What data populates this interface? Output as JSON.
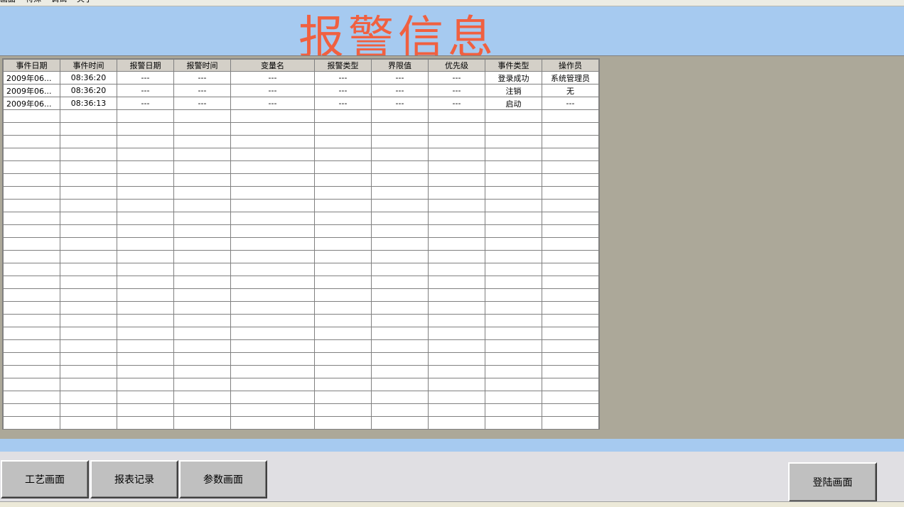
{
  "menu": [
    "画面",
    "特殊",
    "调试",
    "关于"
  ],
  "header": {
    "title": "报警信息"
  },
  "table": {
    "columns": [
      {
        "label": "事件日期",
        "width": 80
      },
      {
        "label": "事件时间",
        "width": 80
      },
      {
        "label": "报警日期",
        "width": 80
      },
      {
        "label": "报警时间",
        "width": 80
      },
      {
        "label": "变量名",
        "width": 118
      },
      {
        "label": "报警类型",
        "width": 80
      },
      {
        "label": "界限值",
        "width": 80
      },
      {
        "label": "优先级",
        "width": 80
      },
      {
        "label": "事件类型",
        "width": 80
      },
      {
        "label": "操作员",
        "width": 80
      }
    ],
    "rows": [
      [
        "2009年06...",
        "08:36:20",
        "---",
        "---",
        "---",
        "---",
        "---",
        "---",
        "登录成功",
        "系统管理员"
      ],
      [
        "2009年06...",
        "08:36:20",
        "---",
        "---",
        "---",
        "---",
        "---",
        "---",
        "注销",
        "无"
      ],
      [
        "2009年06...",
        "08:36:13",
        "---",
        "---",
        "---",
        "---",
        "---",
        "---",
        "启动",
        "---"
      ]
    ],
    "empty_rows": 25
  },
  "buttons": {
    "process": "工艺画面",
    "report": "报表记录",
    "params": "参数画面",
    "login": "登陆画面"
  }
}
